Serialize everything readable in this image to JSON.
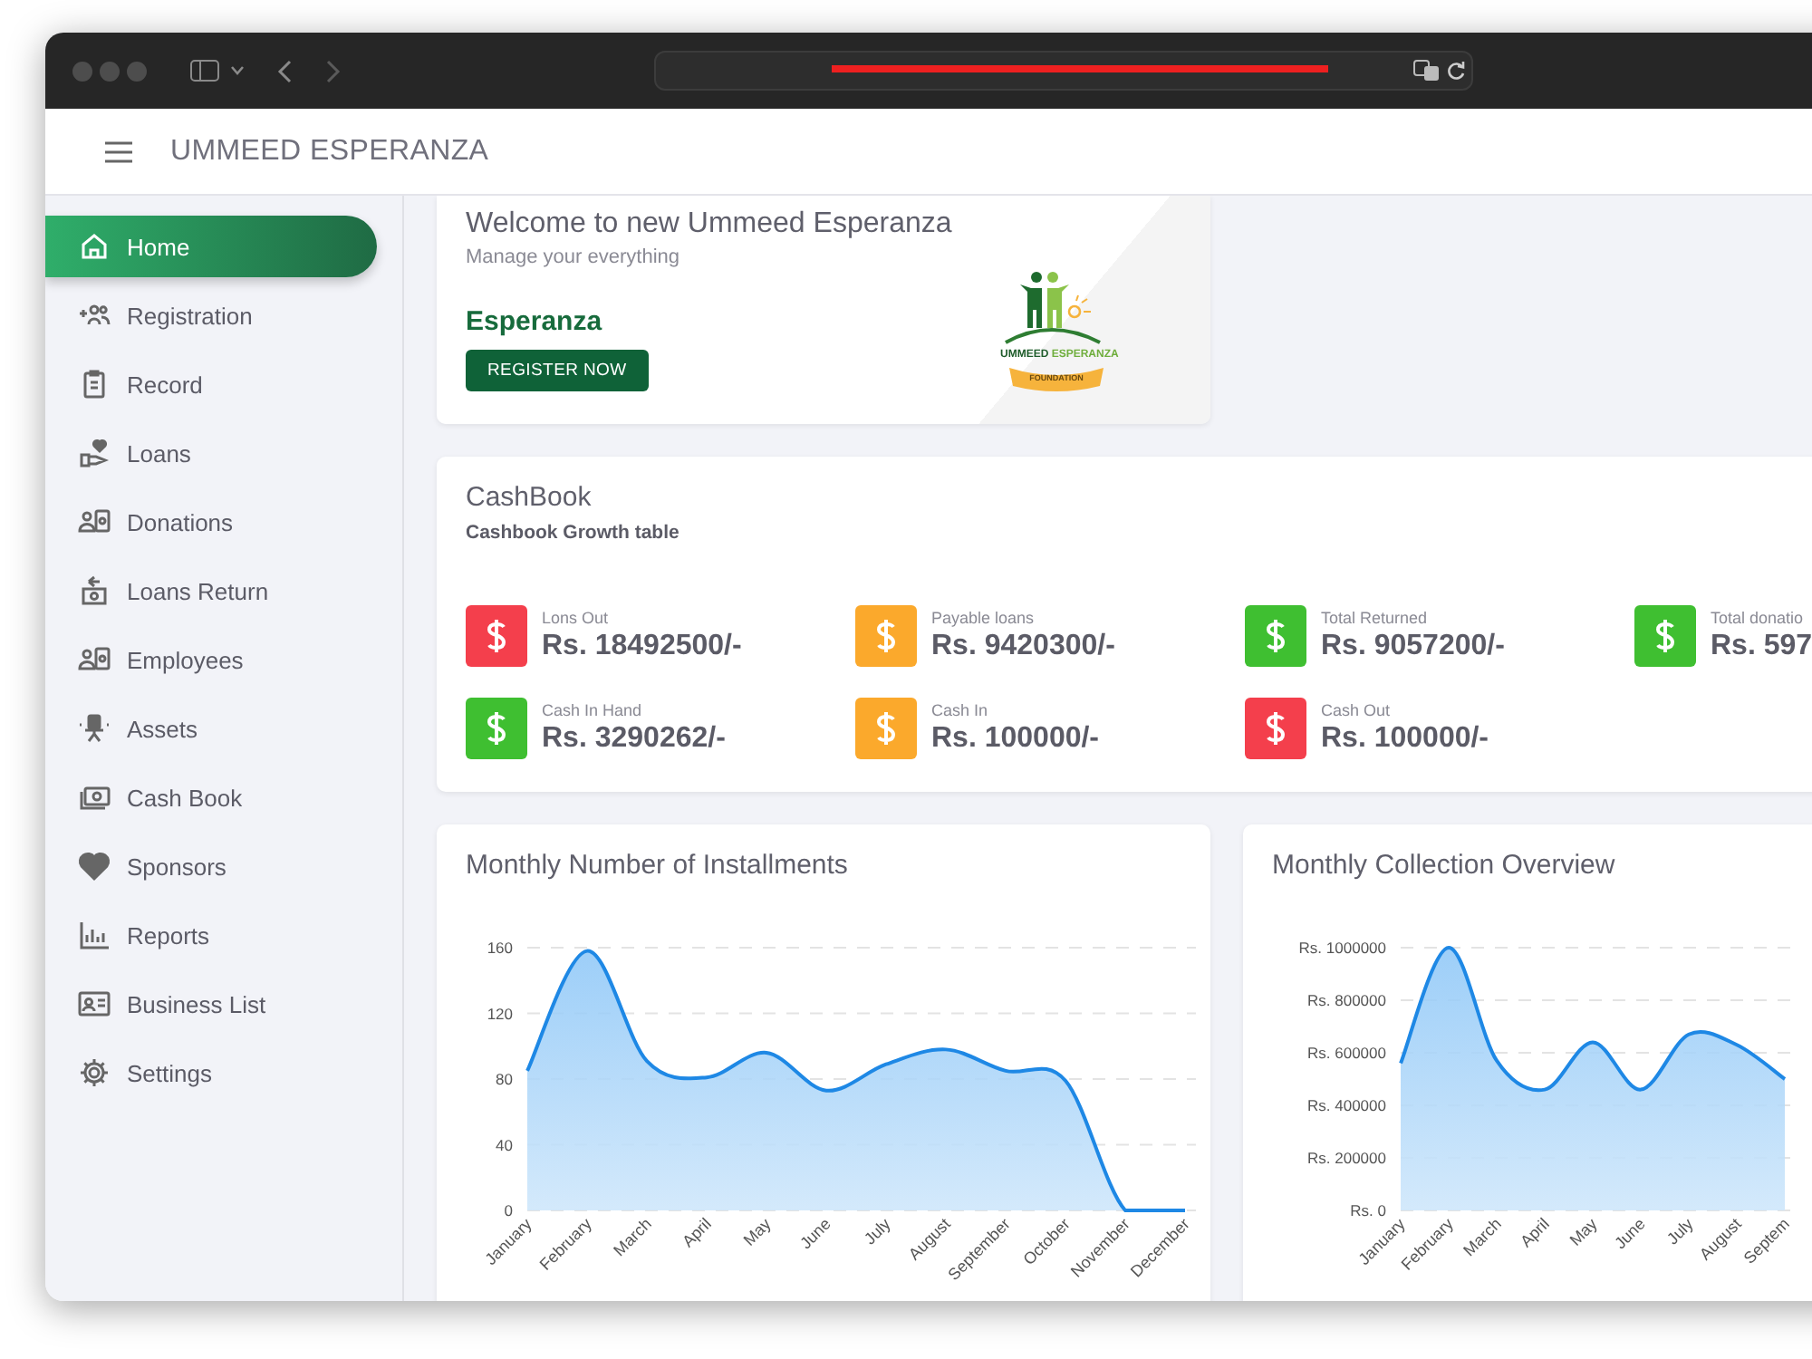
{
  "app": {
    "title": "UMMEED ESPERANZA"
  },
  "sidebar": {
    "items": [
      {
        "label": "Home",
        "selected": true
      },
      {
        "label": "Registration",
        "selected": false
      },
      {
        "label": "Record",
        "selected": false
      },
      {
        "label": "Loans",
        "selected": false
      },
      {
        "label": "Donations",
        "selected": false
      },
      {
        "label": "Loans Return",
        "selected": false
      },
      {
        "label": "Employees",
        "selected": false
      },
      {
        "label": "Assets",
        "selected": false
      },
      {
        "label": "Cash Book",
        "selected": false
      },
      {
        "label": "Sponsors",
        "selected": false
      },
      {
        "label": "Reports",
        "selected": false
      },
      {
        "label": "Business List",
        "selected": false
      },
      {
        "label": "Settings",
        "selected": false
      }
    ]
  },
  "welcome": {
    "title": "Welcome to new Ummeed Esperanza",
    "subtitle": "Manage your everything",
    "brand": "Esperanza",
    "button": "REGISTER NOW",
    "logo": {
      "name_1": "UMMEED",
      "name_2": "ESPERANZA",
      "ribbon": "FOUNDATION"
    }
  },
  "cashbook": {
    "title": "CashBook",
    "subtitle": "Cashbook Growth table",
    "stats": [
      {
        "label": "Lons Out",
        "value": "Rs. 18492500/-",
        "color": "#f43f4c"
      },
      {
        "label": "Payable loans",
        "value": "Rs. 9420300/-",
        "color": "#fba92c"
      },
      {
        "label": "Total Returned",
        "value": "Rs. 9057200/-",
        "color": "#3fbf31"
      },
      {
        "label": "Total donatio",
        "value": "Rs. 597",
        "color": "#3fbf31"
      },
      {
        "label": "Cash In Hand",
        "value": "Rs. 3290262/-",
        "color": "#3fbf31"
      },
      {
        "label": "Cash In",
        "value": "Rs. 100000/-",
        "color": "#fba92c"
      },
      {
        "label": "Cash Out",
        "value": "Rs. 100000/-",
        "color": "#f43f4c"
      }
    ]
  },
  "charts": [
    {
      "title": "Monthly Number of Installments",
      "chart_data": {
        "type": "area",
        "categories": [
          "January",
          "February",
          "March",
          "April",
          "May",
          "June",
          "July",
          "August",
          "September",
          "October",
          "November",
          "December"
        ],
        "series": [
          {
            "color": "#1e88e5",
            "values": [
              85,
              158,
              91,
              81,
              96,
              73,
              89,
              98,
              85,
              79,
              0,
              0
            ]
          }
        ],
        "grid": true,
        "ylim": [
          0,
          160
        ],
        "yticks": [
          0,
          40,
          80,
          120,
          160
        ]
      }
    },
    {
      "title": "Monthly Collection Overview",
      "chart_data": {
        "type": "area",
        "categories": [
          "January",
          "February",
          "March",
          "April",
          "May",
          "June",
          "July",
          "August",
          "Septem"
        ],
        "series": [
          {
            "color": "#1e88e5",
            "values": [
              560000,
              1000000,
              570000,
              460000,
              640000,
              460000,
              670000,
              630000,
              500000
            ]
          }
        ],
        "grid": true,
        "ylim": [
          0,
          1000000
        ],
        "yticks": [
          {
            "value": 0,
            "label": "Rs. 0"
          },
          {
            "value": 200000,
            "label": "Rs. 200000"
          },
          {
            "value": 400000,
            "label": "Rs. 400000"
          },
          {
            "value": 600000,
            "label": "Rs. 600000"
          },
          {
            "value": 800000,
            "label": "Rs. 800000"
          },
          {
            "value": 1000000,
            "label": "Rs. 1000000"
          }
        ]
      }
    }
  ]
}
